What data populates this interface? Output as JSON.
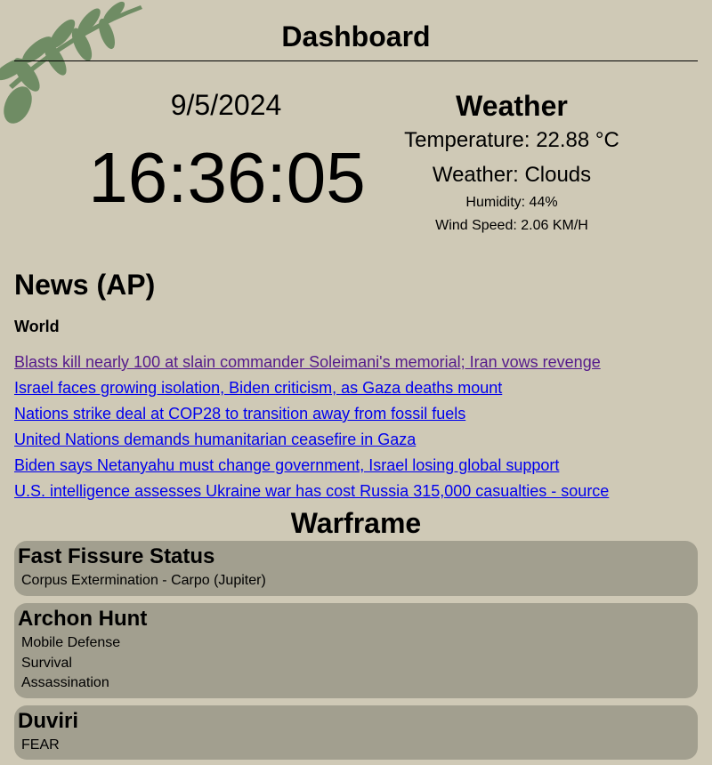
{
  "header": {
    "title": "Dashboard"
  },
  "clock": {
    "date": "9/5/2024",
    "time": "16:36:05"
  },
  "weather": {
    "title": "Weather",
    "temperature": "Temperature: 22.88 °C",
    "condition": "Weather: Clouds",
    "humidity": "Humidity: 44%",
    "wind": "Wind Speed: 2.06 KM/H"
  },
  "news": {
    "title": "News (AP)",
    "section": "World",
    "headlines": [
      "Blasts kill nearly 100 at slain commander Soleimani's memorial; Iran vows revenge",
      "Israel faces growing isolation, Biden criticism, as Gaza deaths mount",
      "Nations strike deal at COP28 to transition away from fossil fuels",
      "United Nations demands humanitarian ceasefire in Gaza",
      "Biden says Netanyahu must change government, Israel losing global support",
      "U.S. intelligence assesses Ukraine war has cost Russia 315,000 casualties - source"
    ]
  },
  "warframe": {
    "title": "Warframe",
    "fissure": {
      "title": "Fast Fissure Status",
      "items": [
        "Corpus Extermination - Carpo (Jupiter)"
      ]
    },
    "archon": {
      "title": "Archon Hunt",
      "items": [
        "Mobile Defense",
        "Survival",
        "Assassination"
      ]
    },
    "duviri": {
      "title": "Duviri",
      "items": [
        "FEAR"
      ]
    }
  },
  "colors": {
    "background": "#cfc9b6",
    "card": "#a29f8f",
    "leaf": "#6f8c64",
    "link": "#0000ee",
    "visited_link": "#551a8b"
  }
}
